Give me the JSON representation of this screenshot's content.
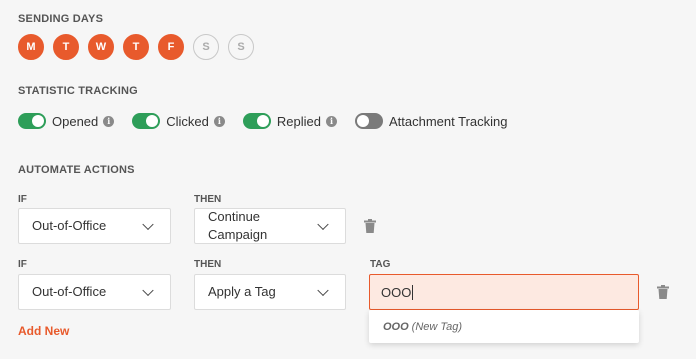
{
  "sending_days": {
    "title": "SENDING DAYS",
    "days": [
      {
        "label": "M",
        "active": true
      },
      {
        "label": "T",
        "active": true
      },
      {
        "label": "W",
        "active": true
      },
      {
        "label": "T",
        "active": true
      },
      {
        "label": "F",
        "active": true
      },
      {
        "label": "S",
        "active": false
      },
      {
        "label": "S",
        "active": false
      }
    ]
  },
  "statistic_tracking": {
    "title": "STATISTIC TRACKING",
    "items": [
      {
        "label": "Opened",
        "on": true,
        "info": true
      },
      {
        "label": "Clicked",
        "on": true,
        "info": true
      },
      {
        "label": "Replied",
        "on": true,
        "info": true
      },
      {
        "label": "Attachment Tracking",
        "on": false,
        "info": false
      }
    ]
  },
  "automate_actions": {
    "title": "AUTOMATE ACTIONS",
    "rows": [
      {
        "if_label": "IF",
        "if_value": "Out-of-Office",
        "then_label": "THEN",
        "then_value": "Continue Campaign"
      },
      {
        "if_label": "IF",
        "if_value": "Out-of-Office",
        "then_label": "THEN",
        "then_value": "Apply a Tag",
        "tag_label": "TAG",
        "tag_value": "OOO"
      }
    ],
    "tag_suggestion": {
      "name": "OOO",
      "note": "(New Tag)"
    },
    "add_new_label": "Add New"
  },
  "colors": {
    "accent": "#e85a2c",
    "toggle_on": "#2e9e59",
    "toggle_off": "#7a7a7a"
  }
}
